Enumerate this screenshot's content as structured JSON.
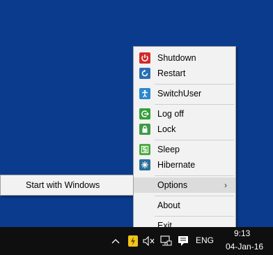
{
  "menu": {
    "items": [
      {
        "label": "Shutdown",
        "icon": "power-icon",
        "color": "#d42a2a"
      },
      {
        "label": "Restart",
        "icon": "restart-icon",
        "color": "#2a6fb5"
      },
      {
        "label": "SwitchUser",
        "icon": "person-icon",
        "color": "#2b89cf"
      },
      {
        "label": "Log off",
        "icon": "logoff-icon",
        "color": "#35a03a"
      },
      {
        "label": "Lock",
        "icon": "lock-icon",
        "color": "#3d9b48"
      },
      {
        "label": "Sleep",
        "icon": "sleep-icon",
        "color": "#4aa83c"
      },
      {
        "label": "Hibernate",
        "icon": "hibernate-icon",
        "color": "#2a6f9a"
      },
      {
        "label": "Options"
      },
      {
        "label": "About"
      },
      {
        "label": "Exit"
      }
    ]
  },
  "submenu": {
    "items": [
      {
        "label": "Start with Windows"
      }
    ]
  },
  "taskbar": {
    "language": "ENG",
    "time": "9:13",
    "date": "04-Jan-16"
  }
}
